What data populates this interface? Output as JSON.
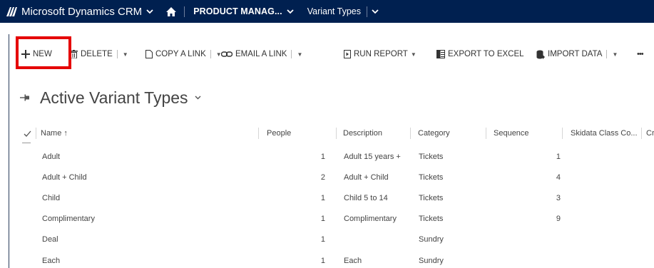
{
  "navbar": {
    "brand": "Microsoft Dynamics CRM",
    "area": "PRODUCT MANAG...",
    "entity": "Variant Types",
    "bg_color": "#002050"
  },
  "commands": {
    "new": "NEW",
    "delete": "DELETE",
    "copy_link": "COPY A LINK",
    "email_link": "EMAIL A LINK",
    "run_report": "RUN REPORT",
    "export_excel": "EXPORT TO EXCEL",
    "import_data": "IMPORT DATA",
    "more": "•••",
    "highlight_color": "#e50000"
  },
  "view": {
    "title": "Active Variant Types",
    "pin_icon": "pin-icon",
    "chevron_icon": "chevron-down-icon"
  },
  "grid": {
    "columns": {
      "name": "Name ↑",
      "people": "People",
      "description": "Description",
      "category": "Category",
      "sequence": "Sequence",
      "skidata": "Skidata Class Co...",
      "last": "Cr"
    },
    "rows": [
      {
        "name": "Adult",
        "people": "1",
        "description": "Adult 15 years +",
        "category": "Tickets",
        "sequence": "1"
      },
      {
        "name": "Adult + Child",
        "people": "2",
        "description": "Adult + Child",
        "category": "Tickets",
        "sequence": "4"
      },
      {
        "name": "Child",
        "people": "1",
        "description": "Child 5 to 14",
        "category": "Tickets",
        "sequence": "3"
      },
      {
        "name": "Complimentary",
        "people": "1",
        "description": "Complimentary",
        "category": "Tickets",
        "sequence": "9"
      },
      {
        "name": "Deal",
        "people": "1",
        "description": "",
        "category": "Sundry",
        "sequence": ""
      },
      {
        "name": "Each",
        "people": "1",
        "description": "Each",
        "category": "Sundry",
        "sequence": ""
      }
    ]
  }
}
